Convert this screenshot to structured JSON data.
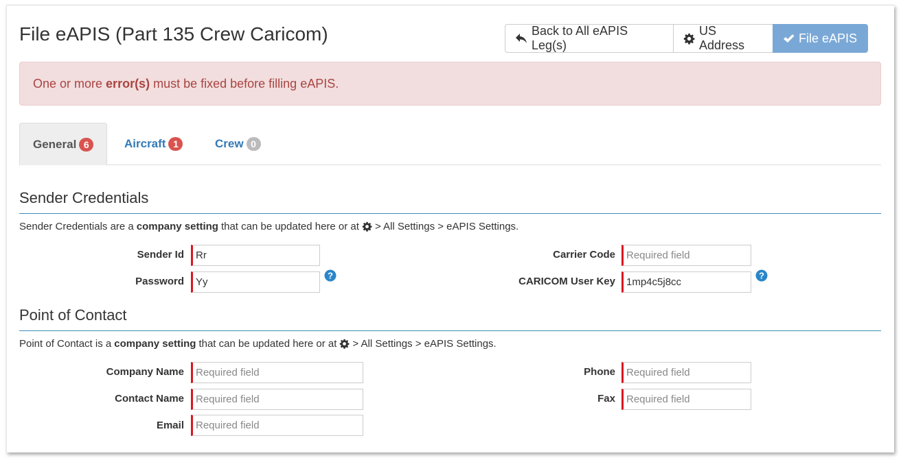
{
  "header": {
    "title": "File eAPIS (Part 135 Crew Caricom)",
    "buttons": {
      "back": "Back to All eAPIS Leg(s)",
      "us_address": "US Address",
      "file": "File eAPIS"
    }
  },
  "alert": {
    "prefix": "One or more",
    "bold": "error(s)",
    "suffix": "must be fixed before filling eAPIS."
  },
  "tabs": [
    {
      "label": "General",
      "count": "6"
    },
    {
      "label": "Aircraft",
      "count": "1"
    },
    {
      "label": "Crew",
      "count": "0"
    }
  ],
  "sender": {
    "heading": "Sender Credentials",
    "note_prefix": "Sender Credentials are a",
    "note_bold": "company setting",
    "note_mid": "that can be updated here or at",
    "note_suffix": "> All Settings > eAPIS Settings.",
    "sender_id": {
      "label": "Sender Id",
      "value": "Rr"
    },
    "password": {
      "label": "Password",
      "value": "Yy"
    },
    "carrier_code": {
      "label": "Carrier Code",
      "value": "",
      "placeholder": "Required field"
    },
    "caricom_key": {
      "label": "CARICOM User Key",
      "value": "1mp4c5j8cc"
    }
  },
  "contact": {
    "heading": "Point of Contact",
    "note_prefix": "Point of Contact is a",
    "note_bold": "company setting",
    "note_mid": "that can be updated here or at",
    "note_suffix": "> All Settings > eAPIS Settings.",
    "company_name": {
      "label": "Company Name",
      "placeholder": "Required field"
    },
    "contact_name": {
      "label": "Contact Name",
      "placeholder": "Required field"
    },
    "email": {
      "label": "Email",
      "placeholder": "Required field"
    },
    "phone": {
      "label": "Phone",
      "placeholder": "Required field"
    },
    "fax": {
      "label": "Fax",
      "placeholder": "Required field"
    }
  },
  "colors": {
    "accent": "#337ab7",
    "error": "#a94442",
    "badge_red": "#d9534f",
    "required_border": "#d9161f",
    "section_rule": "#3a8fb7"
  },
  "icons": {
    "back": "reply-arrow-icon",
    "us_address": "gear-icon",
    "file": "check-icon",
    "help": "question-circle-icon"
  }
}
